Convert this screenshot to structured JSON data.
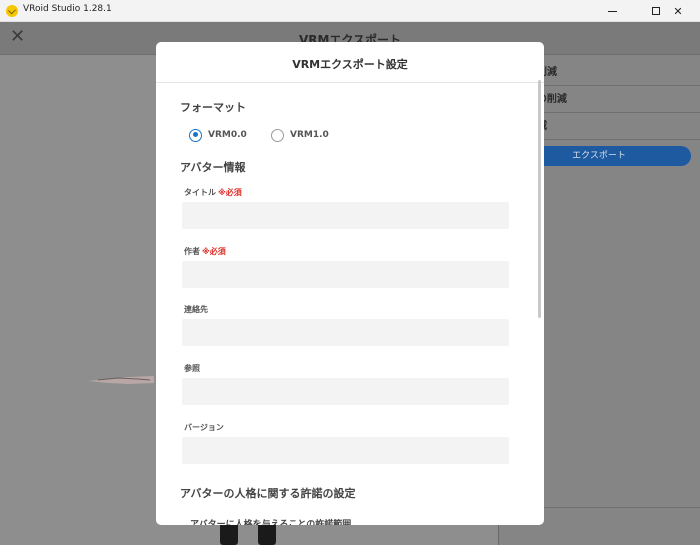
{
  "window": {
    "title": "VRoid Studio 1.28.1"
  },
  "header": {
    "title": "VRMエクスポート",
    "close_icon": "close-icon"
  },
  "right_panel": {
    "items": [
      "ゴンの削減",
      "リアルの削減",
      "ンの削減"
    ],
    "export_label": "エクスポート"
  },
  "dialog": {
    "title": "VRMエクスポート設定",
    "format": {
      "heading": "フォーマット",
      "options": [
        {
          "label": "VRM0.0",
          "selected": true
        },
        {
          "label": "VRM1.0",
          "selected": false
        }
      ]
    },
    "avatar_info": {
      "heading": "アバター情報",
      "required_mark": "※必須",
      "fields": [
        {
          "label": "タイトル",
          "required": true,
          "value": ""
        },
        {
          "label": "作者",
          "required": true,
          "value": ""
        },
        {
          "label": "連絡先",
          "required": false,
          "value": ""
        },
        {
          "label": "参照",
          "required": false,
          "value": ""
        },
        {
          "label": "バージョン",
          "required": false,
          "value": ""
        }
      ]
    },
    "permissions": {
      "heading": "アバターの人格に関する許諾の設定",
      "sub_label": "アバターに人格を与えることの許諾範囲"
    }
  },
  "colors": {
    "accent": "#1a73c7",
    "required": "#e0312a",
    "export_button": "#1e5aa0"
  }
}
